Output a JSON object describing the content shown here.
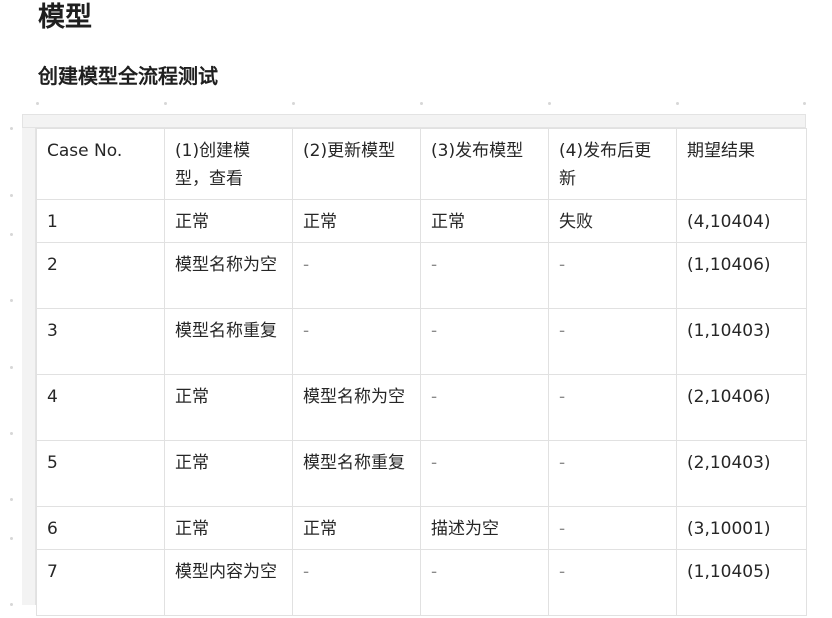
{
  "page": {
    "title": "模型",
    "subtitle": "创建模型全流程测试"
  },
  "table": {
    "headers": [
      "Case No.",
      "(1)创建模型，查看",
      "(2)更新模型",
      "(3)发布模型",
      "(4)发布后更新",
      "期望结果"
    ],
    "rows": [
      [
        "1",
        "正常",
        "正常",
        "正常",
        "失败",
        "(4,10404)"
      ],
      [
        "2",
        "模型名称为空",
        "-",
        "-",
        "-",
        "(1,10406)"
      ],
      [
        "3",
        "模型名称重复",
        "-",
        "-",
        "-",
        "(1,10403)"
      ],
      [
        "4",
        "正常",
        "模型名称为空",
        "-",
        "-",
        "(2,10406)"
      ],
      [
        "5",
        "正常",
        "模型名称重复",
        "-",
        "-",
        "(2,10403)"
      ],
      [
        "6",
        "正常",
        "正常",
        "描述为空",
        "-",
        "(3,10001)"
      ],
      [
        "7",
        "模型内容为空",
        "-",
        "-",
        "-",
        "(1,10405)"
      ]
    ]
  }
}
